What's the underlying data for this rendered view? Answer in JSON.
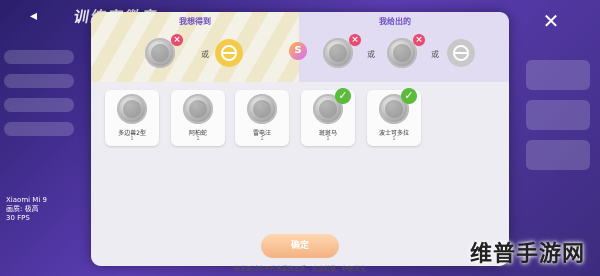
{
  "background": {
    "title": "训练家徽章",
    "device": {
      "model": "Xiaomi Mi 9",
      "quality": "画质: 极高",
      "fps": "30 FPS"
    }
  },
  "trade": {
    "want_title": "我想得到",
    "give_title": "我给出的",
    "or_label": "或",
    "swap_icon": "S",
    "remove_glyph": "×"
  },
  "cards": [
    {
      "name": "多边兽2型",
      "count": "1",
      "checked": false
    },
    {
      "name": "阿柏蛇",
      "count": "1",
      "checked": false
    },
    {
      "name": "雷电汪",
      "count": "1",
      "checked": false
    },
    {
      "name": "斑斑马",
      "count": "1",
      "checked": true
    },
    {
      "name": "波士可多拉",
      "count": "1",
      "checked": true
    }
  ],
  "confirm_label": "确定",
  "close_glyph": "✕",
  "back_glyph": "◂",
  "check_glyph": "✓",
  "footer": "技术测试中不代表最终品质，欢迎批量，积极优化",
  "watermark": "维普手游网",
  "colors": {
    "accent": "#6d4fc2",
    "x_badge": "#e84a70",
    "check": "#5dbb3c",
    "confirm": "#f3b282"
  }
}
